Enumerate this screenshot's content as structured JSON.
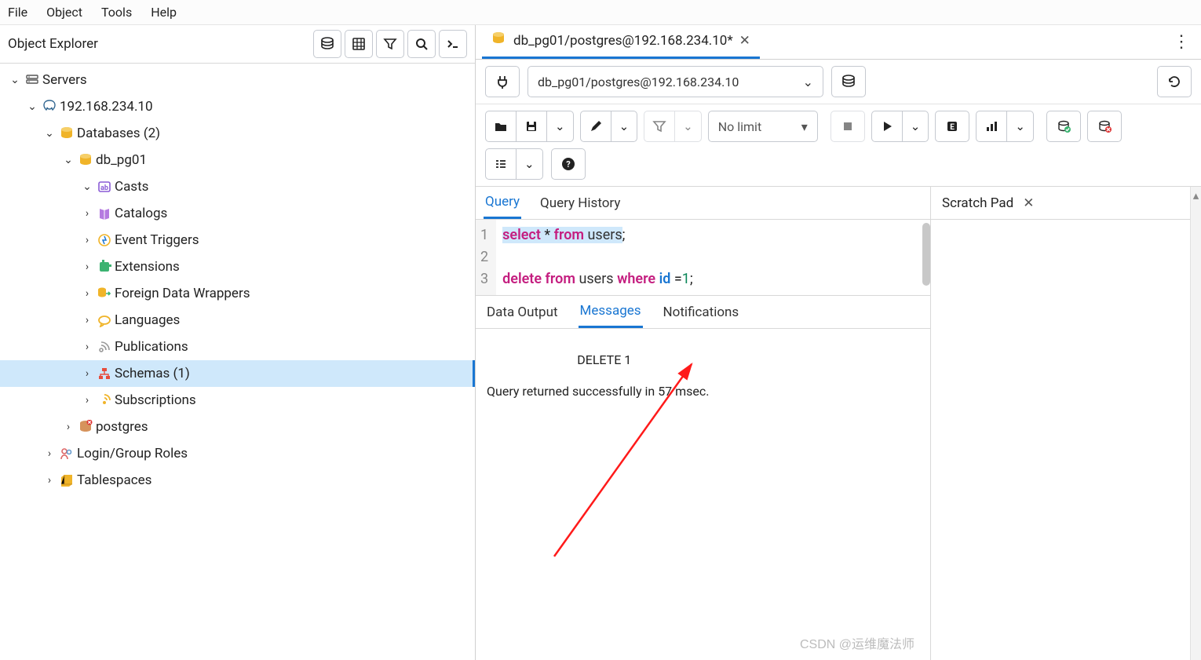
{
  "menubar": [
    "File",
    "Object",
    "Tools",
    "Help"
  ],
  "panel_title": "Object Explorer",
  "tree": {
    "servers": "Servers",
    "server_host": "192.168.234.10",
    "databases": "Databases (2)",
    "db1": "db_pg01",
    "casts": "Casts",
    "catalogs": "Catalogs",
    "event_triggers": "Event Triggers",
    "extensions": "Extensions",
    "fdw": "Foreign Data Wrappers",
    "languages": "Languages",
    "publications": "Publications",
    "schemas": "Schemas (1)",
    "subscriptions": "Subscriptions",
    "postgres": "postgres",
    "login_roles": "Login/Group Roles",
    "tablespaces": "Tablespaces"
  },
  "editor_tab": "db_pg01/postgres@192.168.234.10*",
  "connection": "db_pg01/postgres@192.168.234.10",
  "limit_label": "No limit",
  "query_tabs": {
    "query": "Query",
    "history": "Query History"
  },
  "scratch_pad": "Scratch Pad",
  "code": {
    "l1_kw1": "select",
    "l1_star": " * ",
    "l1_kw2": "from",
    "l1_id": " users",
    "l1_semi": ";",
    "l3_kw1": "delete",
    "l3_kw2": " from",
    "l3_id": " users ",
    "l3_kw3": "where",
    "l3_id2": " id ",
    "l3_eq": "=",
    "l3_num": "1",
    "l3_semi": ";"
  },
  "line_nums": [
    "1",
    "2",
    "3"
  ],
  "output_tabs": {
    "data": "Data Output",
    "messages": "Messages",
    "notifications": "Notifications"
  },
  "messages_text": "DELETE 1\n\nQuery returned successfully in 57 msec.",
  "watermark": "CSDN @运维魔法师",
  "icon_names": {
    "db": "database-icon",
    "grid": "table-icon",
    "filter": "filter-icon",
    "search": "search-icon",
    "term": "terminal-icon",
    "server_group": "server-group-icon",
    "pg": "postgres-icon",
    "dbgold": "database-gold-icon",
    "cast": "cast-icon",
    "catalog": "catalog-icon",
    "event": "event-trigger-icon",
    "ext": "extension-icon",
    "fdw": "fdw-icon",
    "lang": "language-icon",
    "pub": "publication-icon",
    "schema": "schema-icon",
    "sub": "subscription-icon",
    "roles": "roles-icon",
    "ts": "tablespace-icon",
    "plug": "plug-icon",
    "dbbtn": "database-button-icon",
    "refresh": "refresh-icon",
    "folder": "folder-icon",
    "save": "save-icon",
    "edit": "pencil-icon",
    "funnel": "funnel-icon",
    "stop": "stop-icon",
    "play": "play-icon",
    "explain": "explain-icon",
    "chart": "bar-chart-icon",
    "commit": "commit-icon",
    "rollback": "rollback-icon",
    "macro": "macro-icon",
    "help": "help-icon",
    "close": "close-icon",
    "kebab": "kebab-menu-icon",
    "chev": "chevron-down-icon"
  }
}
